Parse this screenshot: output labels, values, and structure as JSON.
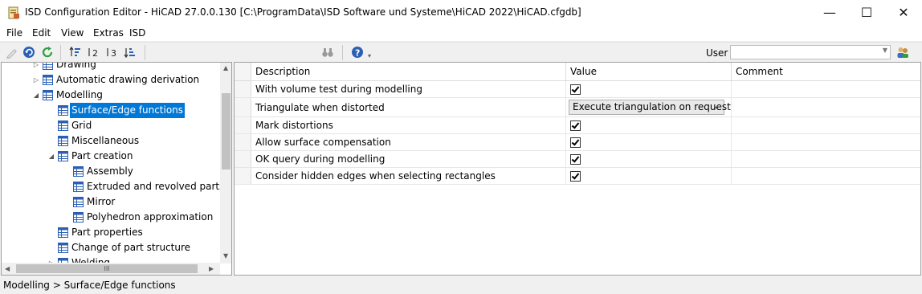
{
  "window": {
    "title": "ISD Configuration Editor - HiCAD 27.0.0.130 [C:\\ProgramData\\ISD Software und Systeme\\HiCAD 2022\\HiCAD.cfgdb]",
    "minimize_glyph": "—",
    "maximize_glyph": "☐",
    "close_glyph": "✕"
  },
  "menu": [
    "File",
    "Edit",
    "View",
    "Extras",
    "ISD"
  ],
  "toolbar": {
    "icons": [
      "pencil-icon",
      "undo-icon",
      "refresh-icon",
      "sort-asc-icon",
      "sort-numbered-icon",
      "sort-3-icon",
      "sort-desc-icon",
      "binoculars-icon",
      "help-icon"
    ],
    "user_label": "User",
    "user_value": ""
  },
  "tree": {
    "items": [
      {
        "label": "Drawing",
        "level": 1,
        "expander": "▷"
      },
      {
        "label": "Automatic drawing derivation",
        "level": 1,
        "expander": "▷"
      },
      {
        "label": "Modelling",
        "level": 1,
        "expander": "◢"
      },
      {
        "label": "Surface/Edge functions",
        "level": 2,
        "expander": "",
        "selected": true
      },
      {
        "label": "Grid",
        "level": 2,
        "expander": ""
      },
      {
        "label": "Miscellaneous",
        "level": 2,
        "expander": ""
      },
      {
        "label": "Part creation",
        "level": 2,
        "expander": "◢"
      },
      {
        "label": "Assembly",
        "level": 3,
        "expander": ""
      },
      {
        "label": "Extruded and revolved parts",
        "level": 3,
        "expander": ""
      },
      {
        "label": "Mirror",
        "level": 3,
        "expander": ""
      },
      {
        "label": "Polyhedron approximation",
        "level": 3,
        "expander": ""
      },
      {
        "label": "Part properties",
        "level": 2,
        "expander": ""
      },
      {
        "label": "Change of part structure",
        "level": 2,
        "expander": ""
      },
      {
        "label": "Welding",
        "level": 2,
        "expander": "▷"
      }
    ],
    "hscroll_grip": "III"
  },
  "grid": {
    "columns": [
      "Description",
      "Value",
      "Comment"
    ],
    "rows": [
      {
        "description": "With volume test during modelling",
        "type": "checkbox",
        "checked": true,
        "comment": ""
      },
      {
        "description": "Triangulate when distorted",
        "type": "dropdown",
        "value": "Execute triangulation on request",
        "comment": ""
      },
      {
        "description": "Mark distortions",
        "type": "checkbox",
        "checked": true,
        "comment": ""
      },
      {
        "description": "Allow surface compensation",
        "type": "checkbox",
        "checked": true,
        "comment": ""
      },
      {
        "description": "OK query during modelling",
        "type": "checkbox",
        "checked": true,
        "comment": ""
      },
      {
        "description": "Consider hidden edges when selecting rectangles",
        "type": "checkbox",
        "checked": true,
        "comment": ""
      }
    ]
  },
  "status": {
    "breadcrumb": "Modelling > Surface/Edge functions"
  },
  "colors": {
    "selection": "#0078d7",
    "icon_blue": "#2b5fb4",
    "icon_green": "#2e9e3e"
  }
}
